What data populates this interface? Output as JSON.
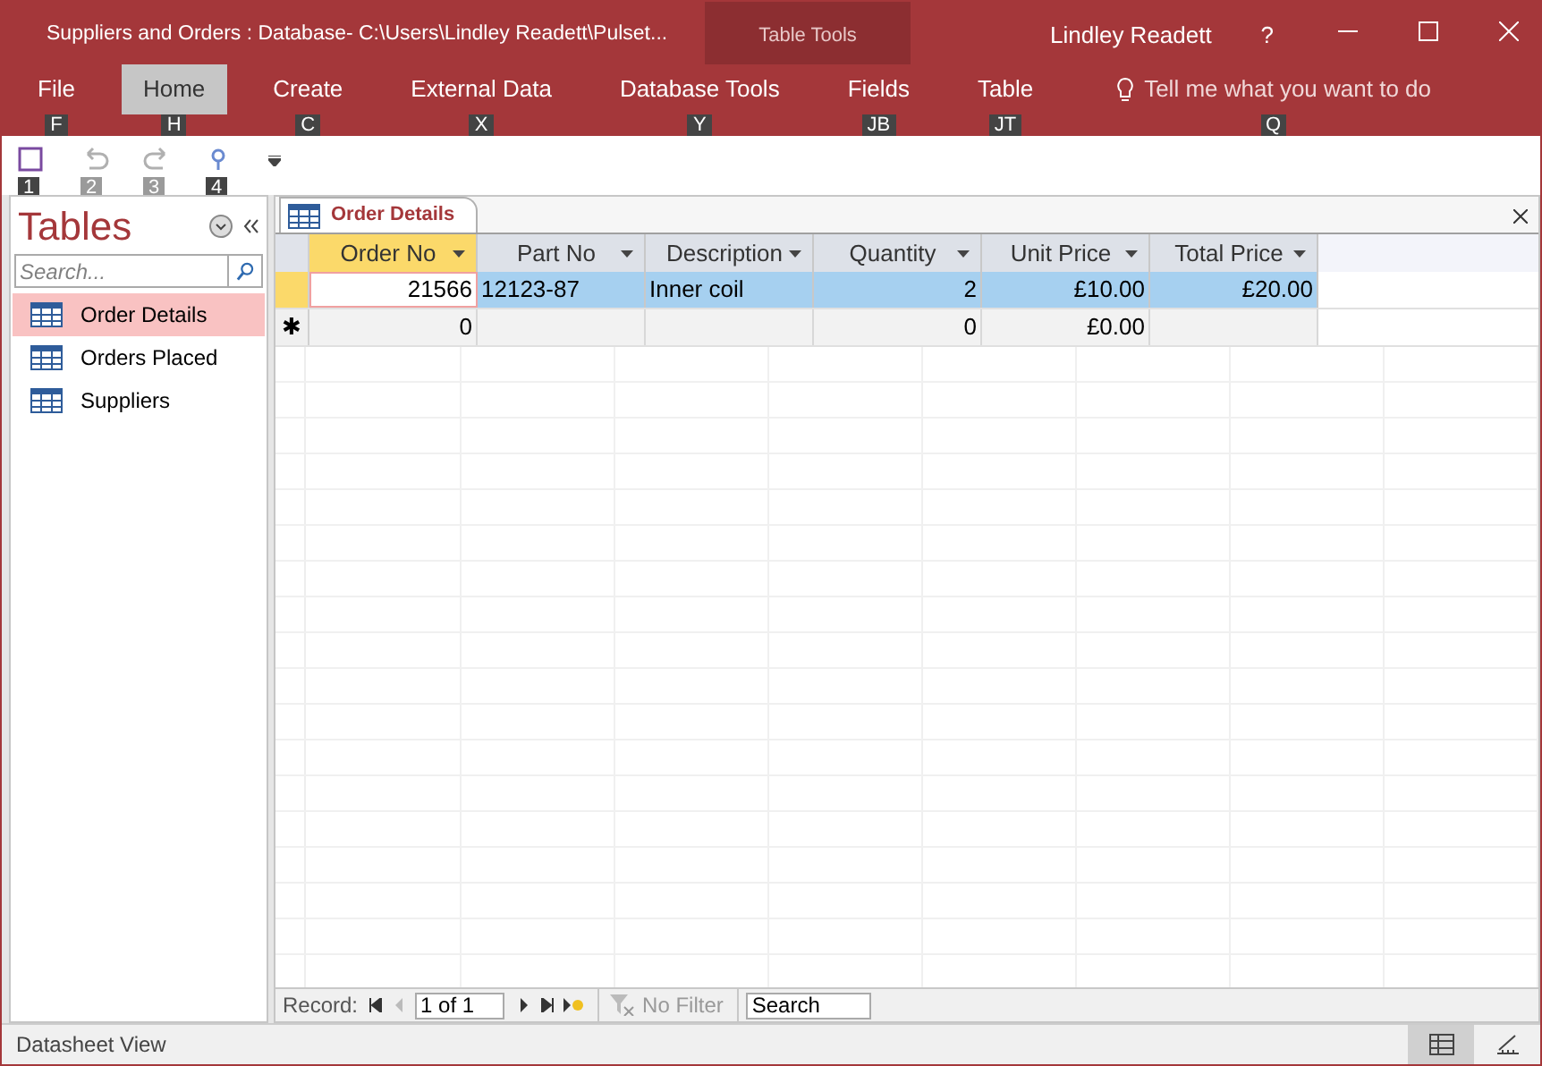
{
  "window": {
    "title": "Suppliers and Orders : Database- C:\\Users\\Lindley Readett\\Pulset...",
    "context": "Table Tools",
    "user": "Lindley Readett",
    "help": "?"
  },
  "ribbon_tabs": [
    {
      "label": "File",
      "key": "F",
      "selected": false
    },
    {
      "label": "Home",
      "key": "H",
      "selected": true
    },
    {
      "label": "Create",
      "key": "C",
      "selected": false
    },
    {
      "label": "External Data",
      "key": "X",
      "selected": false
    },
    {
      "label": "Database Tools",
      "key": "Y",
      "selected": false
    },
    {
      "label": "Fields",
      "key": "JB",
      "selected": false
    },
    {
      "label": "Table",
      "key": "JT",
      "selected": false
    }
  ],
  "tell_me": {
    "text": "Tell me what you want to do",
    "key": "Q"
  },
  "quick_access": [
    {
      "kind": "save",
      "key": "1",
      "disabled": false
    },
    {
      "kind": "undo",
      "key": "2",
      "disabled": true
    },
    {
      "kind": "redo",
      "key": "3",
      "disabled": true
    },
    {
      "kind": "touch",
      "key": "4",
      "disabled": false
    }
  ],
  "nav": {
    "title": "Tables",
    "search": {
      "placeholder": "Search..."
    },
    "items": [
      {
        "label": "Order Details",
        "selected": true
      },
      {
        "label": "Orders Placed",
        "selected": false
      },
      {
        "label": "Suppliers",
        "selected": false
      }
    ]
  },
  "document": {
    "tab": "Order Details",
    "columns": [
      {
        "label": "Order No",
        "active": true,
        "kind": "number"
      },
      {
        "label": "Part No",
        "active": false,
        "kind": "text"
      },
      {
        "label": "Description",
        "active": false,
        "kind": "text"
      },
      {
        "label": "Quantity",
        "active": false,
        "kind": "number"
      },
      {
        "label": "Unit Price",
        "active": false,
        "kind": "number"
      },
      {
        "label": "Total Price",
        "active": false,
        "kind": "number"
      }
    ],
    "rows": [
      {
        "selected": true,
        "cells": [
          "21566",
          "12123-87",
          "Inner coil",
          "2",
          "£10.00",
          "£20.00"
        ]
      },
      {
        "selected": false,
        "marker": "✱",
        "cells": [
          "0",
          null,
          null,
          "0",
          "£0.00",
          null
        ]
      }
    ]
  },
  "record_nav": {
    "label": "Record:",
    "position": "1 of 1",
    "filter": "No Filter",
    "search": {
      "placeholder": "Search"
    }
  },
  "status_bar": {
    "text": "Datasheet View",
    "views": [
      {
        "kind": "datasheet",
        "selected": true
      },
      {
        "kind": "design",
        "selected": false
      }
    ]
  }
}
